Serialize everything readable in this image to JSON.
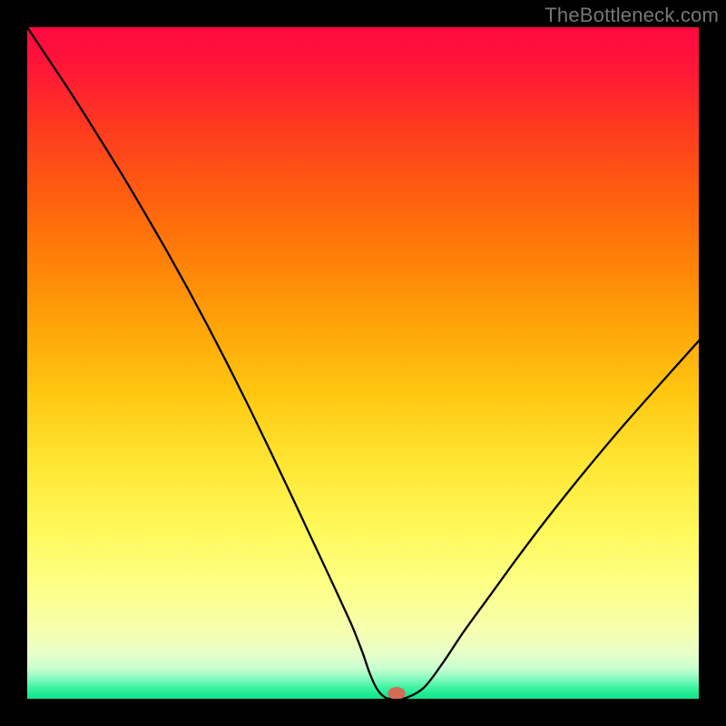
{
  "watermark": "TheBottleneck.com",
  "chart_data": {
    "type": "line",
    "title": "",
    "xlabel": "",
    "ylabel": "",
    "xlim": [
      0,
      100
    ],
    "ylim": [
      0,
      100
    ],
    "grid": false,
    "legend": false,
    "background_gradient_stops": [
      {
        "offset": 0.0,
        "color": "#ff0840"
      },
      {
        "offset": 0.06,
        "color": "#ff1638"
      },
      {
        "offset": 0.15,
        "color": "#ff3a1f"
      },
      {
        "offset": 0.25,
        "color": "#ff5e0f"
      },
      {
        "offset": 0.35,
        "color": "#ff8208"
      },
      {
        "offset": 0.45,
        "color": "#ffa608"
      },
      {
        "offset": 0.55,
        "color": "#ffc912"
      },
      {
        "offset": 0.65,
        "color": "#ffe633"
      },
      {
        "offset": 0.75,
        "color": "#fff95b"
      },
      {
        "offset": 0.83,
        "color": "#feff86"
      },
      {
        "offset": 0.9,
        "color": "#f5ffaf"
      },
      {
        "offset": 0.935,
        "color": "#e5ffc9"
      },
      {
        "offset": 0.955,
        "color": "#c8ffd0"
      },
      {
        "offset": 0.97,
        "color": "#86fbbf"
      },
      {
        "offset": 0.985,
        "color": "#36f19e"
      },
      {
        "offset": 1.0,
        "color": "#0fe487"
      }
    ],
    "series": [
      {
        "name": "bottleneck-curve",
        "color": "#000000",
        "stroke_width": 2.3,
        "x": [
          0,
          3,
          6,
          9,
          12,
          15,
          18,
          21,
          24,
          27,
          30,
          33,
          36,
          39,
          42,
          45,
          48,
          49,
          50,
          51,
          52,
          53,
          54,
          56,
          59,
          62,
          65,
          69,
          73,
          77,
          82,
          88,
          94,
          100
        ],
        "y": [
          100,
          95.5,
          91,
          86.3,
          81.5,
          76.6,
          71.5,
          66.3,
          60.9,
          55.3,
          49.5,
          43.5,
          37.3,
          31.0,
          24.6,
          18.2,
          11.7,
          9.3,
          6.7,
          3.8,
          1.6,
          0.4,
          0.0,
          0.0,
          1.6,
          5.5,
          10.0,
          15.5,
          21.0,
          26.3,
          32.6,
          39.8,
          46.6,
          53.3
        ]
      }
    ],
    "marker": {
      "name": "optimal-point",
      "x": 55,
      "y": 0.8,
      "rx": 1.3,
      "ry": 0.95,
      "fill": "#d46b57"
    }
  }
}
